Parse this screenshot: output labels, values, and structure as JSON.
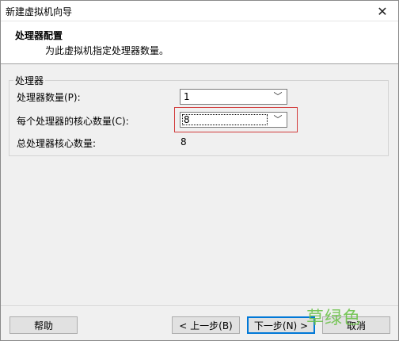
{
  "window": {
    "title": "新建虚拟机向导",
    "close_symbol": "✕"
  },
  "header": {
    "title": "处理器配置",
    "subtitle": "为此虚拟机指定处理器数量。"
  },
  "group": {
    "label": "处理器"
  },
  "fields": {
    "processor_count_label": "处理器数量(P):",
    "processor_count_value": "1",
    "cores_per_processor_label": "每个处理器的核心数量(C):",
    "cores_per_processor_value": "8",
    "total_cores_label": "总处理器核心数量:",
    "total_cores_value": "8"
  },
  "icons": {
    "dropdown_arrow": "﹀"
  },
  "buttons": {
    "help": "帮助",
    "back": "< 上一步(B)",
    "next": "下一步(N) >",
    "cancel": "取消"
  },
  "watermark": "草绿色",
  "colors": {
    "highlight_border": "#d23b3b",
    "default_button_border": "#0078d7",
    "watermark": "#6cc24a"
  }
}
